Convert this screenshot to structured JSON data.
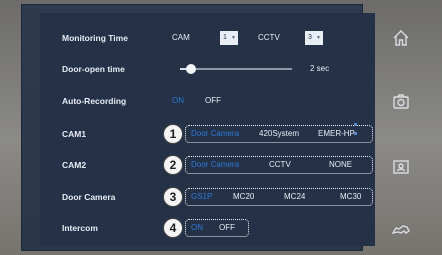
{
  "settings": {
    "monitoring_time": {
      "label": "Monitoring Time",
      "cam_label": "CAM",
      "cam_value": "1",
      "cctv_label": "CCTV",
      "cctv_value": "3"
    },
    "door_open_time": {
      "label": "Door-open time",
      "value_text": "2 sec",
      "level": 0.1
    },
    "auto_recording": {
      "label": "Auto-Recording",
      "options": [
        "ON",
        "OFF"
      ],
      "selected": "ON"
    },
    "cam1": {
      "label": "CAM1",
      "options": [
        "Door Camera",
        "420System",
        "EMER-HP"
      ],
      "selected": "Door Camera",
      "callout": "1"
    },
    "cam2": {
      "label": "CAM2",
      "options": [
        "Door Camera",
        "CCTV",
        "NONE"
      ],
      "selected": "Door Camera",
      "callout": "2"
    },
    "door_camera": {
      "label": "Door Camera",
      "options": [
        "GS1P",
        "MC20",
        "MC24",
        "MC30"
      ],
      "selected": "GS1P",
      "callout": "3"
    },
    "intercom": {
      "label": "Intercom",
      "options": [
        "ON",
        "OFF"
      ],
      "selected": "ON",
      "callout": "4"
    }
  },
  "sidebar": {
    "buttons": [
      "home-icon",
      "camera-icon",
      "contacts-icon",
      "intercom-handset-icon"
    ]
  },
  "colors": {
    "selected_option": "#2f7ad6",
    "panel_bg": "#243147",
    "text": "#e8edf4"
  }
}
